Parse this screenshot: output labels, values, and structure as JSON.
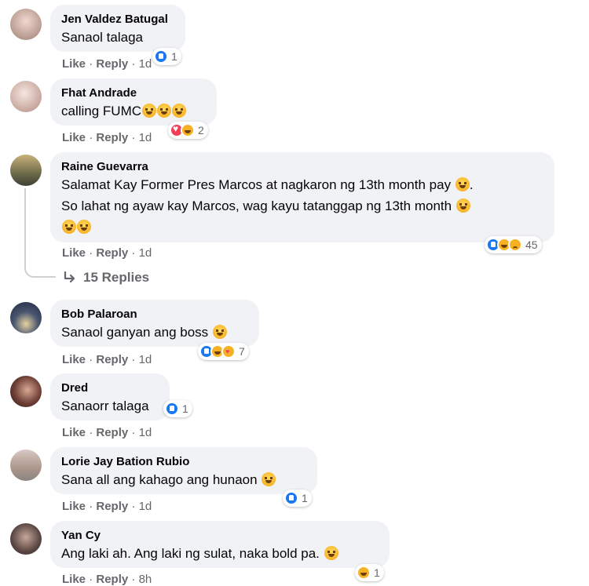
{
  "comments": [
    {
      "author": "Jen Valdez Batugal",
      "text": "Sanaol talaga",
      "like": "Like",
      "reply": "Reply",
      "time": "1d",
      "reaction_count": "1",
      "reactions": [
        "like"
      ],
      "avatar_color": "#c9b3ad"
    },
    {
      "author": "Fhat Andrade",
      "text": "calling FUMC",
      "like": "Like",
      "reply": "Reply",
      "time": "1d",
      "reaction_count": "2",
      "reactions": [
        "love",
        "haha"
      ],
      "avatar_color": "#d9bfb5"
    },
    {
      "author": "Raine Guevarra",
      "line1": "Salamat Kay Former Pres Marcos at nagkaron ng 13th month pay",
      "line2": "So lahat ng ayaw kay Marcos, wag kayu tatanggap ng 13th month",
      "like": "Like",
      "reply": "Reply",
      "time": "1d",
      "reaction_count": "45",
      "reactions": [
        "like",
        "haha",
        "sad"
      ],
      "avatar_color": "#8a7f5e"
    },
    {
      "author": "Bob Palaroan",
      "text": "Sanaol ganyan ang boss",
      "like": "Like",
      "reply": "Reply",
      "time": "1d",
      "reaction_count": "7",
      "reactions": [
        "like",
        "haha",
        "care"
      ],
      "avatar_color": "#2b3a57"
    },
    {
      "author": "Dred",
      "text": "Sanaorr talaga",
      "like": "Like",
      "reply": "Reply",
      "time": "1d",
      "reaction_count": "1",
      "reactions": [
        "like"
      ],
      "avatar_color": "#5a3a33"
    },
    {
      "author": "Lorie Jay Bation Rubio",
      "text": "Sana all ang kahago ang hunaon",
      "like": "Like",
      "reply": "Reply",
      "time": "1d",
      "reaction_count": "1",
      "reactions": [
        "like"
      ],
      "avatar_color": "#b7a39a"
    },
    {
      "author": "Yan Cy",
      "text": "Ang laki ah. Ang laki ng sulat, naka bold pa.",
      "like": "Like",
      "reply": "Reply",
      "time": "8h",
      "reaction_count": "1",
      "reactions": [
        "haha"
      ],
      "avatar_color": "#4a3c3a"
    }
  ],
  "replies_label": "15 Replies",
  "separator": "·"
}
